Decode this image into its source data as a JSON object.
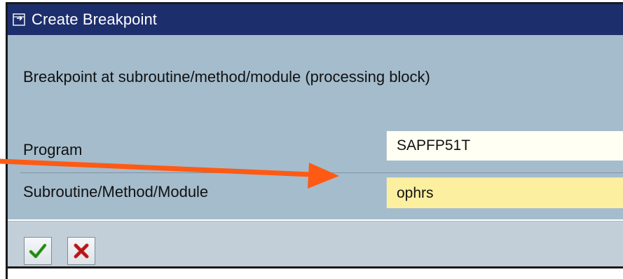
{
  "dialog": {
    "title": "Create Breakpoint",
    "description": "Breakpoint at subroutine/method/module (processing block)",
    "fields": [
      {
        "label": "Program",
        "value": "SAPFP51T"
      },
      {
        "label": "Subroutine/Method/Module",
        "value": "ophrs"
      }
    ],
    "buttons": [
      {
        "icon": "check-icon",
        "color": "#2f9d1d"
      },
      {
        "icon": "cross-icon",
        "color": "#c81d1d"
      }
    ]
  },
  "annotation": {
    "arrow_color": "#ff5a14"
  }
}
